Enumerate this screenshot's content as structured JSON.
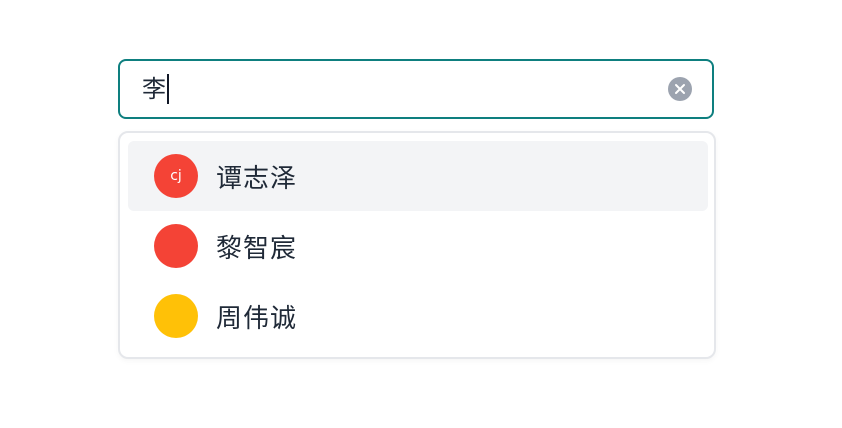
{
  "search": {
    "value": "李",
    "clear_icon": "close-icon",
    "accent_color": "#0e7f7f"
  },
  "results": [
    {
      "name": "谭志泽",
      "avatar_text": "cj",
      "avatar_color": "#f44336",
      "highlighted": true
    },
    {
      "name": "黎智宸",
      "avatar_text": "",
      "avatar_color": "#f44336",
      "highlighted": false
    },
    {
      "name": "周伟诚",
      "avatar_text": "",
      "avatar_color": "#ffc107",
      "highlighted": false
    }
  ]
}
